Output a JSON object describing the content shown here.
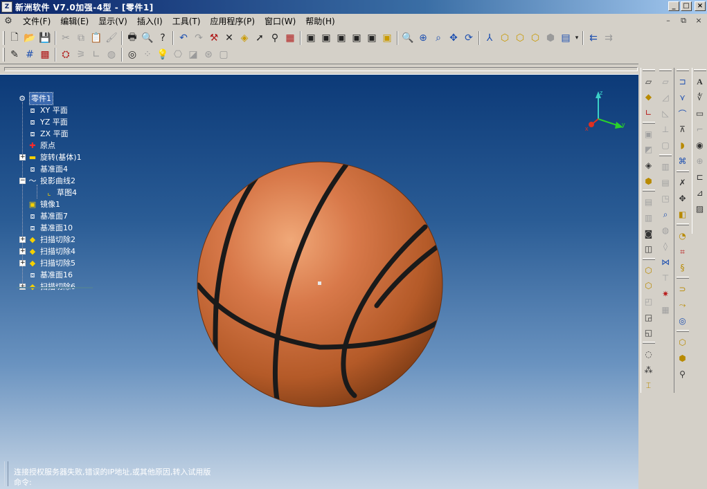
{
  "window": {
    "title": "新洲软件 V7.0加强-4型 - [零件1]",
    "app_icon": "app-logo-icon",
    "controls": [
      "_",
      "□",
      "×"
    ],
    "mdi_controls": [
      "–",
      "⧉",
      "×"
    ]
  },
  "menu": {
    "items": [
      "文件(F)",
      "编辑(E)",
      "显示(V)",
      "插入(I)",
      "工具(T)",
      "应用程序(P)",
      "窗口(W)",
      "帮助(H)"
    ]
  },
  "toolbar1": {
    "icons": [
      "new-icon",
      "open-icon",
      "save-icon",
      "cut-icon",
      "copy-icon",
      "paste-icon",
      "format-painter-icon",
      "print-icon",
      "print-preview-icon",
      "help-icon",
      "undo-icon",
      "redo-icon",
      "rebuild-icon",
      "delete-icon",
      "properties-icon",
      "select-icon",
      "select-filter-icon",
      "measure-icon",
      "view-front-icon",
      "view-back-icon",
      "view-top-icon",
      "view-side-icon",
      "view-iso-icon",
      "view-normal-icon",
      "zoom-fit-icon",
      "zoom-in-icon",
      "zoom-window-icon",
      "pan-icon",
      "rotate-icon",
      "axis-icon",
      "cube-shaded-icon",
      "cube-wire-icon",
      "cube-hidden-icon",
      "cube-solid-icon",
      "display-mode-icon",
      "layout-left-icon",
      "layout-right-icon"
    ]
  },
  "toolbar2": {
    "icons": [
      "sketch-pencil-icon",
      "grid-icon",
      "color-icon",
      "feature-icon",
      "bound-icon",
      "angle-icon",
      "sphere-icon",
      "render-icon",
      "spheres-icon",
      "light-icon",
      "camera-icon",
      "texture-icon",
      "decal-icon",
      "scene-icon"
    ]
  },
  "tree": {
    "root": "零件1",
    "items": [
      {
        "label": "XY 平面",
        "icon": "plane-icon",
        "expander": ""
      },
      {
        "label": "YZ 平面",
        "icon": "plane-icon",
        "expander": ""
      },
      {
        "label": "ZX 平面",
        "icon": "plane-icon",
        "expander": ""
      },
      {
        "label": "原点",
        "icon": "origin-icon",
        "expander": ""
      },
      {
        "label": "旋转(基体)1",
        "icon": "revolve-feature-icon",
        "expander": "+"
      },
      {
        "label": "基准面4",
        "icon": "plane-icon",
        "expander": ""
      },
      {
        "label": "投影曲线2",
        "icon": "curve-icon",
        "expander": "−"
      },
      {
        "label": "草图4",
        "icon": "sketch-icon",
        "expander": "",
        "child": true
      },
      {
        "label": "镜像1",
        "icon": "mirror-feature-icon",
        "expander": ""
      },
      {
        "label": "基准面7",
        "icon": "plane-icon",
        "expander": ""
      },
      {
        "label": "基准面10",
        "icon": "plane-icon",
        "expander": ""
      },
      {
        "label": "扫描切除2",
        "icon": "sweep-cut-icon",
        "expander": "+"
      },
      {
        "label": "扫描切除4",
        "icon": "sweep-cut-icon",
        "expander": "+"
      },
      {
        "label": "扫描切除5",
        "icon": "sweep-cut-icon",
        "expander": "+"
      },
      {
        "label": "基准面16",
        "icon": "plane-icon",
        "expander": ""
      },
      {
        "label": "扫描切除6",
        "icon": "sweep-cut-icon",
        "expander": "+"
      }
    ]
  },
  "axes": {
    "x": "x",
    "y": "y",
    "z": "z"
  },
  "model": {
    "name": "basketball",
    "ball_color": "#c8652e",
    "seam_color": "#1a1a1a"
  },
  "status": {
    "message": "连接授权服务器失败,错误的IP地址,或其他原因,转入试用版",
    "command": "命令:"
  },
  "colors": {
    "viewport_top": "#0c3a78",
    "viewport_bottom": "#c7d6e6",
    "titlebar": "#0a246a",
    "chrome": "#d4d0c8"
  }
}
